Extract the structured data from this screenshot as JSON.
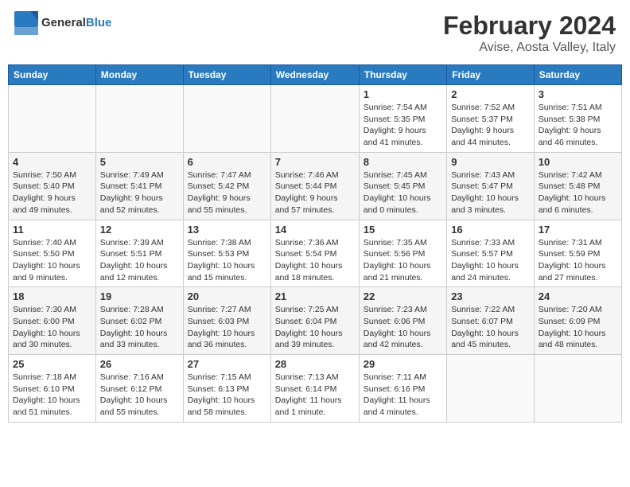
{
  "header": {
    "logo_general": "General",
    "logo_blue": "Blue",
    "month_title": "February 2024",
    "location": "Avise, Aosta Valley, Italy"
  },
  "columns": [
    "Sunday",
    "Monday",
    "Tuesday",
    "Wednesday",
    "Thursday",
    "Friday",
    "Saturday"
  ],
  "weeks": [
    [
      {
        "num": "",
        "info": ""
      },
      {
        "num": "",
        "info": ""
      },
      {
        "num": "",
        "info": ""
      },
      {
        "num": "",
        "info": ""
      },
      {
        "num": "1",
        "info": "Sunrise: 7:54 AM\nSunset: 5:35 PM\nDaylight: 9 hours\nand 41 minutes."
      },
      {
        "num": "2",
        "info": "Sunrise: 7:52 AM\nSunset: 5:37 PM\nDaylight: 9 hours\nand 44 minutes."
      },
      {
        "num": "3",
        "info": "Sunrise: 7:51 AM\nSunset: 5:38 PM\nDaylight: 9 hours\nand 46 minutes."
      }
    ],
    [
      {
        "num": "4",
        "info": "Sunrise: 7:50 AM\nSunset: 5:40 PM\nDaylight: 9 hours\nand 49 minutes."
      },
      {
        "num": "5",
        "info": "Sunrise: 7:49 AM\nSunset: 5:41 PM\nDaylight: 9 hours\nand 52 minutes."
      },
      {
        "num": "6",
        "info": "Sunrise: 7:47 AM\nSunset: 5:42 PM\nDaylight: 9 hours\nand 55 minutes."
      },
      {
        "num": "7",
        "info": "Sunrise: 7:46 AM\nSunset: 5:44 PM\nDaylight: 9 hours\nand 57 minutes."
      },
      {
        "num": "8",
        "info": "Sunrise: 7:45 AM\nSunset: 5:45 PM\nDaylight: 10 hours\nand 0 minutes."
      },
      {
        "num": "9",
        "info": "Sunrise: 7:43 AM\nSunset: 5:47 PM\nDaylight: 10 hours\nand 3 minutes."
      },
      {
        "num": "10",
        "info": "Sunrise: 7:42 AM\nSunset: 5:48 PM\nDaylight: 10 hours\nand 6 minutes."
      }
    ],
    [
      {
        "num": "11",
        "info": "Sunrise: 7:40 AM\nSunset: 5:50 PM\nDaylight: 10 hours\nand 9 minutes."
      },
      {
        "num": "12",
        "info": "Sunrise: 7:39 AM\nSunset: 5:51 PM\nDaylight: 10 hours\nand 12 minutes."
      },
      {
        "num": "13",
        "info": "Sunrise: 7:38 AM\nSunset: 5:53 PM\nDaylight: 10 hours\nand 15 minutes."
      },
      {
        "num": "14",
        "info": "Sunrise: 7:36 AM\nSunset: 5:54 PM\nDaylight: 10 hours\nand 18 minutes."
      },
      {
        "num": "15",
        "info": "Sunrise: 7:35 AM\nSunset: 5:56 PM\nDaylight: 10 hours\nand 21 minutes."
      },
      {
        "num": "16",
        "info": "Sunrise: 7:33 AM\nSunset: 5:57 PM\nDaylight: 10 hours\nand 24 minutes."
      },
      {
        "num": "17",
        "info": "Sunrise: 7:31 AM\nSunset: 5:59 PM\nDaylight: 10 hours\nand 27 minutes."
      }
    ],
    [
      {
        "num": "18",
        "info": "Sunrise: 7:30 AM\nSunset: 6:00 PM\nDaylight: 10 hours\nand 30 minutes."
      },
      {
        "num": "19",
        "info": "Sunrise: 7:28 AM\nSunset: 6:02 PM\nDaylight: 10 hours\nand 33 minutes."
      },
      {
        "num": "20",
        "info": "Sunrise: 7:27 AM\nSunset: 6:03 PM\nDaylight: 10 hours\nand 36 minutes."
      },
      {
        "num": "21",
        "info": "Sunrise: 7:25 AM\nSunset: 6:04 PM\nDaylight: 10 hours\nand 39 minutes."
      },
      {
        "num": "22",
        "info": "Sunrise: 7:23 AM\nSunset: 6:06 PM\nDaylight: 10 hours\nand 42 minutes."
      },
      {
        "num": "23",
        "info": "Sunrise: 7:22 AM\nSunset: 6:07 PM\nDaylight: 10 hours\nand 45 minutes."
      },
      {
        "num": "24",
        "info": "Sunrise: 7:20 AM\nSunset: 6:09 PM\nDaylight: 10 hours\nand 48 minutes."
      }
    ],
    [
      {
        "num": "25",
        "info": "Sunrise: 7:18 AM\nSunset: 6:10 PM\nDaylight: 10 hours\nand 51 minutes."
      },
      {
        "num": "26",
        "info": "Sunrise: 7:16 AM\nSunset: 6:12 PM\nDaylight: 10 hours\nand 55 minutes."
      },
      {
        "num": "27",
        "info": "Sunrise: 7:15 AM\nSunset: 6:13 PM\nDaylight: 10 hours\nand 58 minutes."
      },
      {
        "num": "28",
        "info": "Sunrise: 7:13 AM\nSunset: 6:14 PM\nDaylight: 11 hours\nand 1 minute."
      },
      {
        "num": "29",
        "info": "Sunrise: 7:11 AM\nSunset: 6:16 PM\nDaylight: 11 hours\nand 4 minutes."
      },
      {
        "num": "",
        "info": ""
      },
      {
        "num": "",
        "info": ""
      }
    ]
  ]
}
